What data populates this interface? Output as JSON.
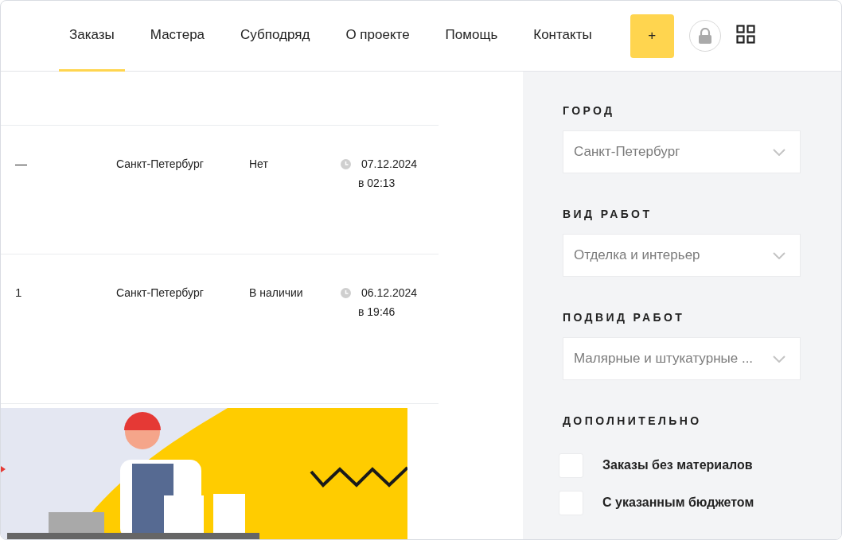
{
  "nav": {
    "items": [
      {
        "label": "Заказы",
        "selected": true
      },
      {
        "label": "Мастера",
        "selected": false
      },
      {
        "label": "Субподряд",
        "selected": false
      },
      {
        "label": "О проекте",
        "selected": false
      },
      {
        "label": "Помощь",
        "selected": false
      },
      {
        "label": "Контакты",
        "selected": false
      }
    ],
    "add_button": "+"
  },
  "orders": [
    {
      "column_1": "—",
      "city": "Санкт-Петербург",
      "materials": "Нет",
      "date": "07.12.2024",
      "time": "в 02:13"
    },
    {
      "column_1": "1",
      "city": "Санкт-Петербург",
      "materials": "В наличии",
      "date": "06.12.2024",
      "time": "в 19:46"
    }
  ],
  "filters": [
    {
      "label": "ГОРОД",
      "value": "Санкт-Петербург"
    },
    {
      "label": "ВИД РАБОТ",
      "value": "Отделка и интерьер"
    },
    {
      "label": "ПОДВИД РАБОТ",
      "value": "Малярные и штукатурные ..."
    }
  ],
  "extra": {
    "label": "ДОПОЛНИТЕЛЬНО",
    "options": [
      {
        "label": "Заказы без материалов",
        "checked": false
      },
      {
        "label": "С указанным бюджетом",
        "checked": false
      }
    ]
  }
}
